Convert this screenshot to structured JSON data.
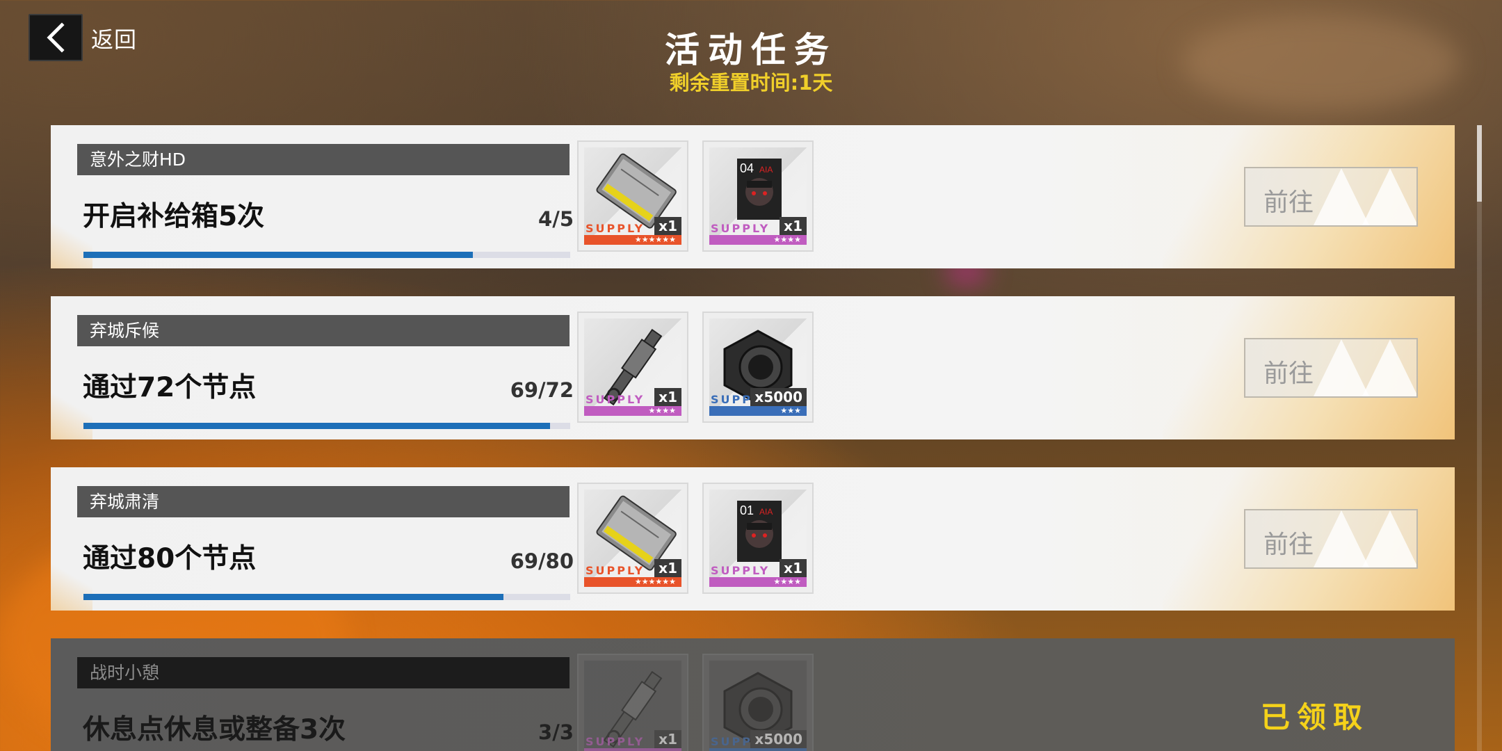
{
  "header": {
    "back_label": "返回",
    "title": "活动任务",
    "reset_label": "剩余重置时间:",
    "reset_value": "1天"
  },
  "tasks": [
    {
      "tag": "意外之财HD",
      "desc": "开启补给箱5次",
      "progress_text": "4/5",
      "progress": 0.8,
      "action": "前往",
      "claimed": false,
      "rewards": [
        {
          "icon": "card-chip-icon",
          "supply": "SUPPLY",
          "stars": "★★★★★★",
          "count": "x1",
          "color": "#e8532a"
        },
        {
          "icon": "character-card-icon",
          "badge": "04",
          "supply": "SUPPLY",
          "stars": "★★★★",
          "count": "x1",
          "color": "#c05cc0"
        }
      ]
    },
    {
      "tag": "弃城斥候",
      "desc": "通过72个节点",
      "progress_text": "69/72",
      "progress": 0.958,
      "action": "前往",
      "claimed": false,
      "rewards": [
        {
          "icon": "rod-component-icon",
          "supply": "SUPPLY",
          "stars": "★★★★",
          "count": "x1",
          "color": "#c05cc0"
        },
        {
          "icon": "hex-nut-icon",
          "supply": "SUPPLY",
          "stars": "★★★",
          "count": "x5000",
          "color": "#3a6eb8"
        }
      ]
    },
    {
      "tag": "弃城肃清",
      "desc": "通过80个节点",
      "progress_text": "69/80",
      "progress": 0.8625,
      "action": "前往",
      "claimed": false,
      "rewards": [
        {
          "icon": "card-chip-icon",
          "supply": "SUPPLY",
          "stars": "★★★★★★",
          "count": "x1",
          "color": "#e8532a"
        },
        {
          "icon": "character-card-icon",
          "badge": "01",
          "supply": "SUPPLY",
          "stars": "★★★★",
          "count": "x1",
          "color": "#c05cc0"
        }
      ]
    },
    {
      "tag": "战时小憩",
      "desc": "休息点休息或整备3次",
      "progress_text": "3/3",
      "progress": 1.0,
      "action": "已领取",
      "claimed": true,
      "rewards": [
        {
          "icon": "rod-component-icon",
          "supply": "SUPPLY",
          "stars": "",
          "count": "x1",
          "color": "#c05cc0"
        },
        {
          "icon": "hex-nut-icon",
          "supply": "SUPPLY",
          "stars": "",
          "count": "x5000",
          "color": "#3a6eb8"
        }
      ]
    }
  ]
}
